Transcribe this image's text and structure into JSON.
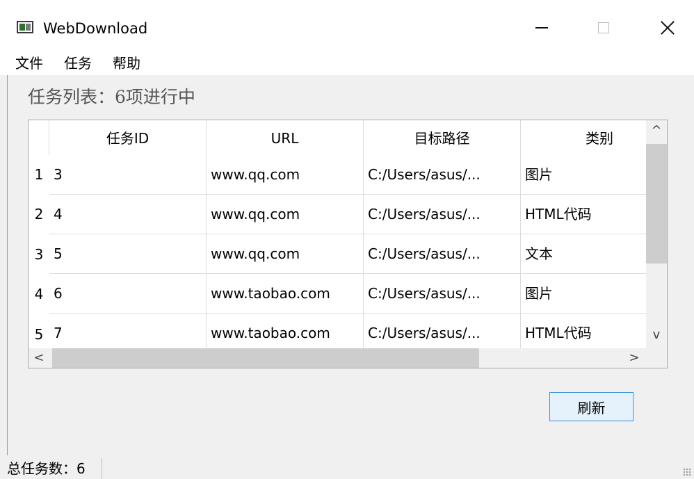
{
  "window": {
    "title": "WebDownload",
    "icon": "app-window-icon",
    "controls": {
      "minimize_icon": "minimize-icon",
      "maximize_icon": "maximize-icon",
      "close_icon": "close-icon"
    }
  },
  "menubar": {
    "items": [
      {
        "label": "文件"
      },
      {
        "label": "任务"
      },
      {
        "label": "帮助"
      }
    ]
  },
  "task_list": {
    "title": "任务列表：6项进行中",
    "columns": [
      "任务ID",
      "URL",
      "目标路径",
      "类别"
    ],
    "rows": [
      {
        "num": "1",
        "id": "3",
        "url": "www.qq.com",
        "path": "C:/Users/asus/...",
        "category": "图片"
      },
      {
        "num": "2",
        "id": "4",
        "url": "www.qq.com",
        "path": "C:/Users/asus/...",
        "category": "HTML代码"
      },
      {
        "num": "3",
        "id": "5",
        "url": "www.qq.com",
        "path": "C:/Users/asus/...",
        "category": "文本"
      },
      {
        "num": "4",
        "id": "6",
        "url": "www.taobao.com",
        "path": "C:/Users/asus/...",
        "category": "图片"
      },
      {
        "num": "5",
        "id": "7",
        "url": "www.taobao.com",
        "path": "C:/Users/asus/...",
        "category": "HTML代码"
      }
    ],
    "scroll": {
      "up_arrow": "^",
      "down_arrow": "v",
      "left_arrow": "<",
      "right_arrow": ">"
    }
  },
  "buttons": {
    "refresh_label": "刷新"
  },
  "statusbar": {
    "text": "总任务数：6"
  }
}
